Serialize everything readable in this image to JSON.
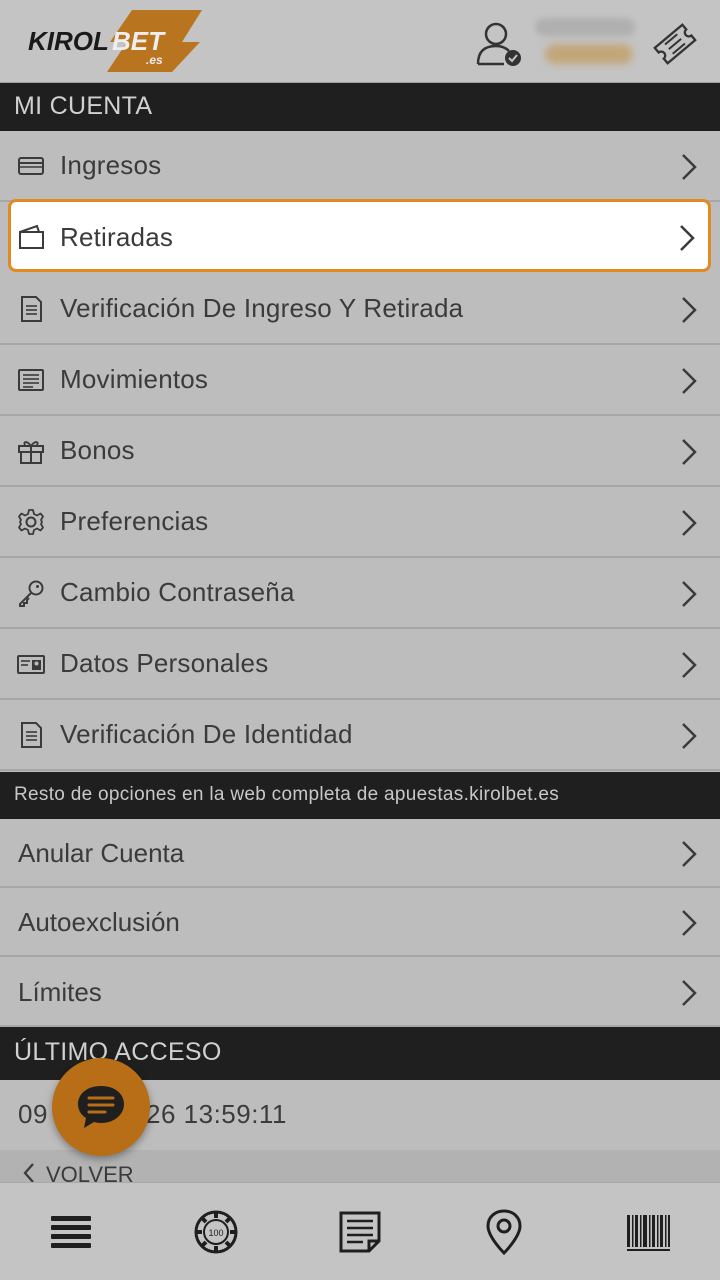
{
  "header": {
    "logo_text": "KIROLBET",
    "logo_suffix": ".es",
    "user_icon": "user-verified-icon",
    "ticket_icon": "ticket-icon"
  },
  "sections": {
    "mi_cuenta": "MI CUENTA",
    "resto": "Resto de opciones en la web completa de apuestas.kirolbet.es",
    "ultimo_acceso": "ÚLTIMO ACCESO"
  },
  "menu": [
    {
      "label": "Ingresos",
      "icon": "card-icon"
    },
    {
      "label": "Retiradas",
      "icon": "wallet-icon"
    },
    {
      "label": "Verificación De Ingreso Y Retirada",
      "icon": "document-icon"
    },
    {
      "label": "Movimientos",
      "icon": "list-icon"
    },
    {
      "label": "Bonos",
      "icon": "gift-icon"
    },
    {
      "label": "Preferencias",
      "icon": "gear-icon"
    },
    {
      "label": "Cambio Contraseña",
      "icon": "key-icon"
    },
    {
      "label": "Datos Personales",
      "icon": "id-card-icon"
    },
    {
      "label": "Verificación De Identidad",
      "icon": "document-icon"
    }
  ],
  "sub_menu": [
    {
      "label": "Anular Cuenta"
    },
    {
      "label": "Autoexclusión"
    },
    {
      "label": "Límites"
    }
  ],
  "last_access": {
    "date_left": "09",
    "date_right": "26 13:59:11"
  },
  "volver_label": "VOLVER",
  "bottom_nav": [
    "menu-icon",
    "casino-chip-icon",
    "bet-slip-icon",
    "location-icon",
    "barcode-icon"
  ],
  "colors": {
    "accent": "#e08a22",
    "chat_button": "#b86e16",
    "dark_bar": "#1f1f1f",
    "overlay_bg": "#bdbdbd"
  }
}
